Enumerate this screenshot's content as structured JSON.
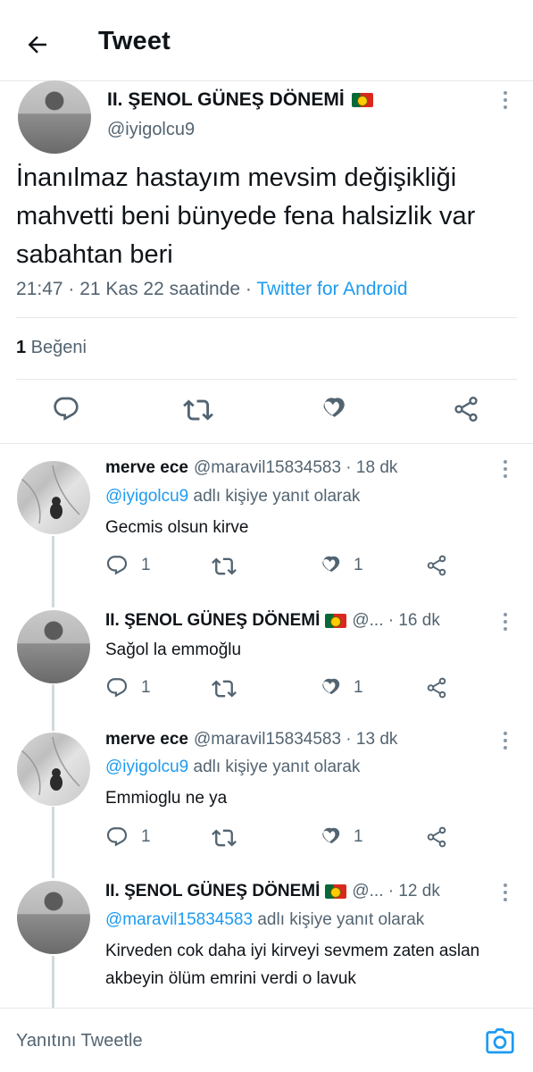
{
  "header": {
    "title": "Tweet"
  },
  "main_tweet": {
    "author_name": "II. ŞENOL GÜNEŞ DÖNEMİ",
    "handle": "@iyigolcu9",
    "text": "İnanılmaz hastayım mevsim değişikliği mahvetti beni bünyede fena halsizlik var sabahtan beri",
    "timestamp": "21:47 · 21 Kas 22 saatinde · ",
    "source": "Twitter for Android",
    "like_count": "1",
    "like_label": " Beğeni"
  },
  "replies": [
    {
      "name": "merve ece",
      "handle": "@maravil15834583 · 18 dk",
      "reply_prefix": "",
      "mention": "@iyigolcu9",
      "reply_suffix": " adlı kişiye yanıt olarak",
      "text": "Gecmis olsun kirve",
      "reply_count": "1",
      "like_count": "1"
    },
    {
      "name": "II. ŞENOL GÜNEŞ DÖNEMİ",
      "handle": "@... · 16 dk",
      "text": "Sağol la emmoğlu",
      "reply_count": "1",
      "like_count": "1"
    },
    {
      "name": "merve ece",
      "handle": "@maravil15834583 · 13 dk",
      "mention": "@iyigolcu9",
      "reply_suffix": " adlı kişiye yanıt olarak",
      "text": "Emmioglu ne ya",
      "reply_count": "1",
      "like_count": "1"
    },
    {
      "name": "II. ŞENOL GÜNEŞ DÖNEMİ",
      "handle": "@... · 12 dk",
      "mention": "@maravil15834583",
      "reply_suffix": " adlı kişiye yanıt olarak",
      "text": "Kirveden cok daha iyi kirveyi sevmem zaten aslan akbeyin ölüm emrini verdi o lavuk"
    }
  ],
  "compose": {
    "placeholder": "Yanıtını Tweetle"
  },
  "icons": {
    "back": "arrow-left-icon",
    "more": "more-vertical-icon",
    "reply": "reply-icon",
    "retweet": "retweet-icon",
    "like": "heart-icon",
    "share": "share-icon",
    "camera": "camera-icon",
    "flag": "portugal-flag-icon"
  },
  "colors": {
    "accent": "#1d9bf0",
    "text": "#0f1419",
    "secondary": "#536471",
    "divider": "#e6e9ea"
  }
}
